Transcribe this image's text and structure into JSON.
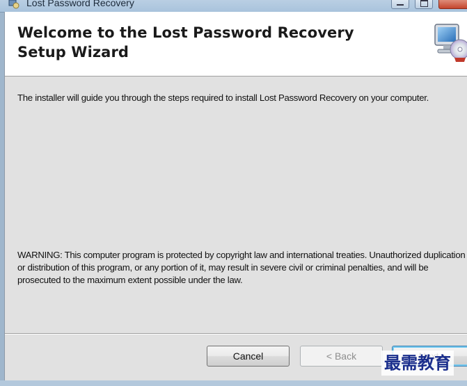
{
  "window": {
    "title": "Lost Password Recovery"
  },
  "banner": {
    "title": "Welcome to the Lost Password Recovery Setup Wizard",
    "icon": "setup-computer-cd-icon"
  },
  "body": {
    "intro": "The installer will guide you through the steps required to install Lost Password Recovery on your computer.",
    "warning": "WARNING: This computer program is protected by copyright law and international treaties. Unauthorized duplication or distribution of this program, or any portion of it, may result in severe civil or criminal penalties, and will be prosecuted to the maximum extent possible under the law."
  },
  "buttons": {
    "cancel": "Cancel",
    "back": "< Back",
    "next": "Next >"
  },
  "watermark": {
    "text": "最需教育"
  },
  "colors": {
    "client_background": "#e1e1e1",
    "banner_background": "#ffffff",
    "next_focus": "#73c9f0",
    "watermark": "#1a2e8c"
  }
}
